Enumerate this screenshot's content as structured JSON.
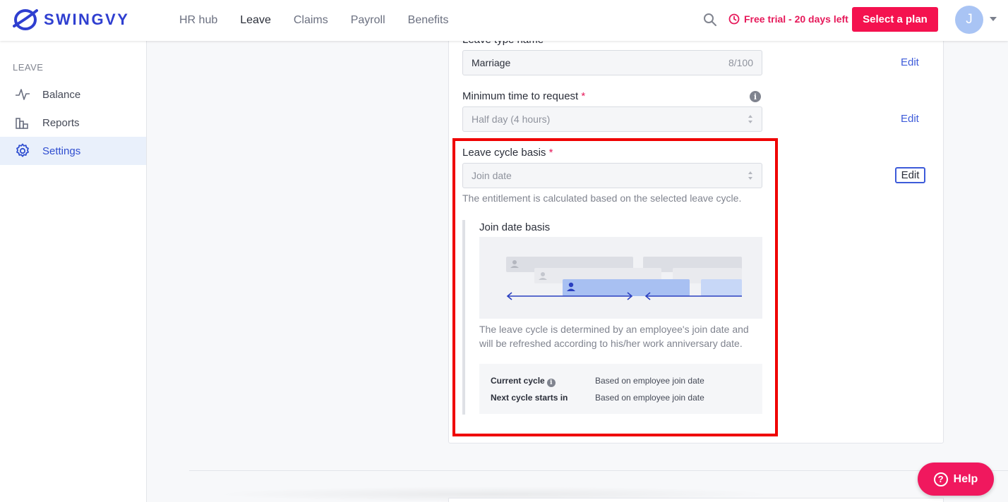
{
  "brand": {
    "name": "SWINGVY",
    "color": "#2f3fd0"
  },
  "nav": {
    "items": [
      {
        "label": "HR hub",
        "active": false
      },
      {
        "label": "Leave",
        "active": true
      },
      {
        "label": "Claims",
        "active": false
      },
      {
        "label": "Payroll",
        "active": false
      },
      {
        "label": "Benefits",
        "active": false
      }
    ]
  },
  "header": {
    "trial_text": "Free trial - 20 days left",
    "select_plan_label": "Select a plan",
    "avatar_initial": "J",
    "accent_color": "#f4124f"
  },
  "sidebar": {
    "section": "LEAVE",
    "items": [
      {
        "label": "Balance",
        "icon": "activity-icon",
        "active": false
      },
      {
        "label": "Reports",
        "icon": "bar-chart-icon",
        "active": false
      },
      {
        "label": "Settings",
        "icon": "gear-icon",
        "active": true
      }
    ]
  },
  "form": {
    "leave_type_name": {
      "label": "Leave type name",
      "value": "Marriage",
      "counter": "8/100",
      "edit": "Edit"
    },
    "min_time": {
      "label": "Minimum time to request",
      "required": "*",
      "value": "Half day (4 hours)",
      "edit": "Edit"
    },
    "cycle_basis": {
      "label": "Leave cycle basis",
      "required": "*",
      "value": "Join date",
      "edit": "Edit",
      "help": "The entitlement is calculated based on the selected leave cycle.",
      "basis_title": "Join date basis",
      "description": "The leave cycle is determined by an employee's join date and will be refreshed according to his/her work anniversary date.",
      "current_cycle_label": "Current cycle",
      "current_cycle_value": "Based on employee join date",
      "next_cycle_label": "Next cycle starts in",
      "next_cycle_value": "Based on employee join date"
    }
  },
  "help_button": {
    "label": "Help"
  }
}
